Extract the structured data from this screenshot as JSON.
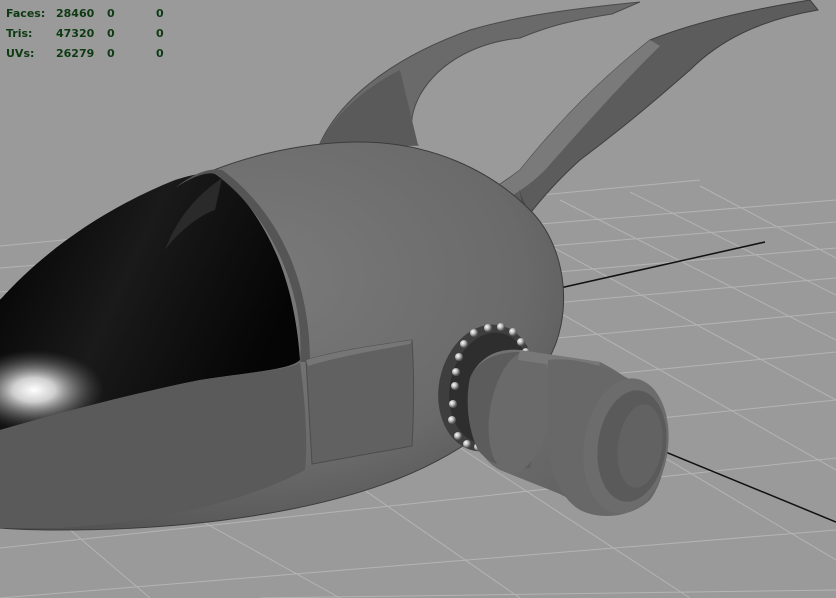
{
  "hud": {
    "rows": [
      {
        "label": "Faces:",
        "values": [
          "28460",
          "0",
          "0"
        ]
      },
      {
        "label": "Tris:",
        "values": [
          "47320",
          "0",
          "0"
        ]
      },
      {
        "label": "UVs:",
        "values": [
          "26279",
          "0",
          "0"
        ]
      }
    ]
  },
  "viewport": {
    "background_color": "#9a9a9a",
    "grid_color": "#b4b4b4",
    "axis_color": "#111111",
    "model_color": "#6e6e6e"
  }
}
